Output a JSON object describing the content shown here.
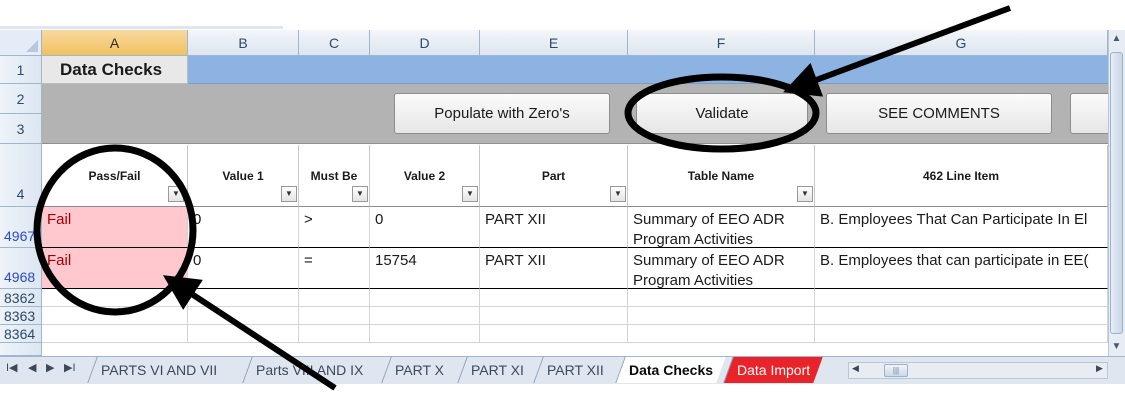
{
  "columns": [
    "A",
    "B",
    "C",
    "D",
    "E",
    "F",
    "G"
  ],
  "rows": {
    "r1": "1",
    "r2": "2",
    "r3": "3",
    "r4": "4",
    "r4967": "4967",
    "r4968": "4968",
    "r8362": "8362",
    "r8363": "8363",
    "r8364": "8364"
  },
  "title": "Data Checks",
  "buttons": {
    "populate": "Populate with Zero's",
    "validate": "Validate",
    "see_comments": "SEE COMMENTS"
  },
  "headers": [
    "Pass/Fail",
    "Value 1",
    "Must Be",
    "Value 2",
    "Part",
    "Table Name",
    "462 Line Item"
  ],
  "data_rows": [
    {
      "pass_fail": "Fail",
      "value1": "0",
      "must_be": ">",
      "value2": "0",
      "part": "PART XII",
      "table_name": "Summary of EEO ADR Program Activities",
      "line_item": "B. Employees That Can Participate In El"
    },
    {
      "pass_fail": "Fail",
      "value1": "0",
      "must_be": "=",
      "value2": "15754",
      "part": "PART XII",
      "table_name": "Summary of EEO ADR Program Activities",
      "line_item": "B. Employees that can participate in EE("
    }
  ],
  "tabs": [
    "PARTS VI AND VII",
    "Parts VIII AND IX",
    "PART X",
    "PART XI",
    "PART XII",
    "Data Checks",
    "Data Import"
  ],
  "colors": {
    "fail_fill": "#ffc7ce",
    "fail_text": "#9c0006",
    "title_bar": "#8db3e2",
    "button_bar": "#b3b3b3",
    "import_tab": "#e8232a"
  }
}
